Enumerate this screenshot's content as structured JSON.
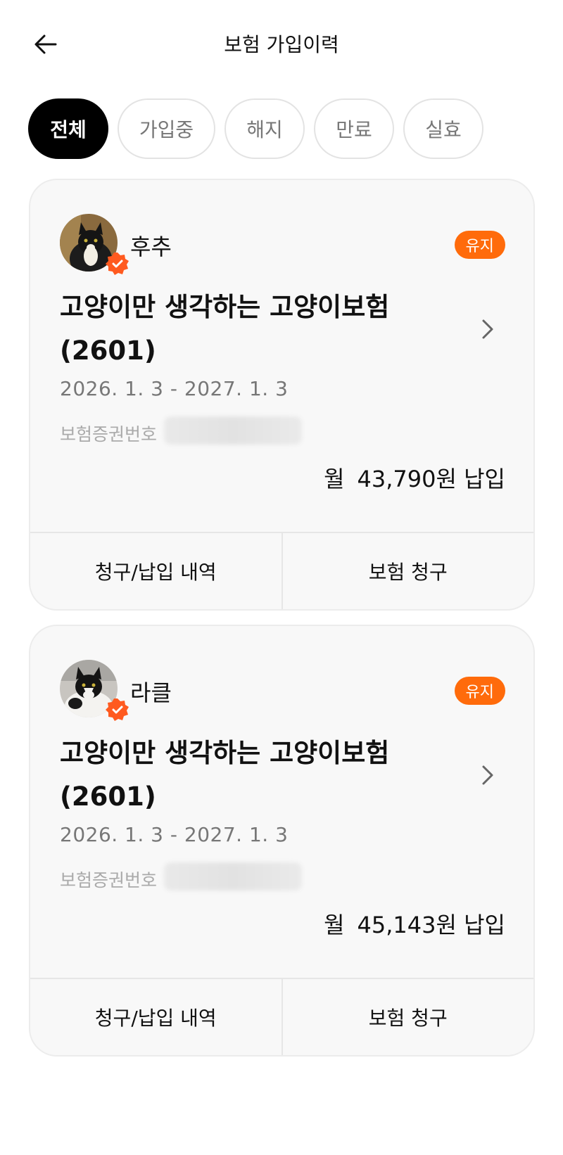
{
  "header": {
    "title": "보험 가입이력",
    "back_icon": "arrow-left-icon"
  },
  "filters": [
    {
      "label": "전체",
      "active": true
    },
    {
      "label": "가입중",
      "active": false
    },
    {
      "label": "해지",
      "active": false
    },
    {
      "label": "만료",
      "active": false
    },
    {
      "label": "실효",
      "active": false
    }
  ],
  "policies": [
    {
      "pet_name": "후추",
      "status": "유지",
      "product_name": "고양이만 생각하는 고양이보험 (2601)",
      "period": "2026. 1. 3 - 2027. 1. 3",
      "policy_number_label": "보험증권번호",
      "premium_prefix": "월",
      "premium_amount": "43,790원 납입",
      "actions": [
        "청구/납입 내역",
        "보험 청구"
      ]
    },
    {
      "pet_name": "라클",
      "status": "유지",
      "product_name": "고양이만 생각하는 고양이보험 (2601)",
      "period": "2026. 1. 3 - 2027. 1. 3",
      "policy_number_label": "보험증권번호",
      "premium_prefix": "월",
      "premium_amount": "45,143원 납입",
      "actions": [
        "청구/납입 내역",
        "보험 청구"
      ]
    }
  ],
  "colors": {
    "accent": "#ff6b0b",
    "chip_active_bg": "#000000",
    "card_bg": "#f8f8f8"
  }
}
